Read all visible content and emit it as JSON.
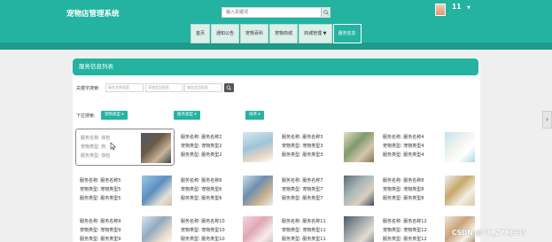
{
  "header": {
    "brand": "宠物店管理系统",
    "search_placeholder": "输入关键词",
    "username": "11",
    "user_caret": "▼"
  },
  "nav": [
    {
      "label": "首页",
      "active": false
    },
    {
      "label": "通知公告",
      "active": false
    },
    {
      "label": "宠物百科",
      "active": false
    },
    {
      "label": "宠物商城",
      "active": false
    },
    {
      "label": "商城管理 ▼",
      "active": false
    },
    {
      "label": "服务信息",
      "active": true
    }
  ],
  "panel": {
    "title": "服务信息列表",
    "keyword_label": "关键字搜索:",
    "inputs": [
      "服务名称搜索",
      "宠物类型搜索",
      "服务类型搜索"
    ],
    "dropdown_label": "下拉搜索:",
    "dropdowns": [
      "宠物类型 ▾",
      "服务类型 ▾",
      "排序 ▾"
    ]
  },
  "cards": [
    {
      "name": "服务名称: 体检",
      "pet": "宠物类型: 狗",
      "service": "服务类型: 体检",
      "photo": "dog-on-lap"
    },
    {
      "name": "服务名称: 服务名称2",
      "pet": "宠物类型: 宠物类型2",
      "service": "服务类型: 服务类型2",
      "photo": "vet-with-kitten"
    },
    {
      "name": "服务名称: 服务名称3",
      "pet": "宠物类型: 宠物类型3",
      "service": "服务类型: 服务类型3",
      "photo": "vet-exam-room"
    },
    {
      "name": "服务名称: 服务名称4",
      "pet": "宠物类型: 宠物类型4",
      "service": "服务类型: 服务类型4",
      "photo": "white-puppy"
    },
    {
      "name": "服务名称: 服务名称5",
      "pet": "宠物类型: 宠物类型5",
      "service": "服务类型: 服务类型5",
      "photo": "vet-in-blue"
    },
    {
      "name": "服务名称: 服务名称6",
      "pet": "宠物类型: 宠物类型6",
      "service": "服务类型: 服务类型6",
      "photo": "vet-with-dog"
    },
    {
      "name": "服务名称: 服务名称7",
      "pet": "宠物类型: 宠物类型7",
      "service": "服务类型: 服务类型7",
      "photo": "clinic-scene"
    },
    {
      "name": "服务名称: 服务名称8",
      "pet": "宠物类型: 宠物类型8",
      "service": "服务类型: 服务类型8",
      "photo": "vet-with-golden-dog"
    },
    {
      "name": "服务名称: 服务名称9",
      "pet": "宠物类型: 宠物类型9",
      "service": "服务类型: 服务类型9",
      "photo": "vet-smiling"
    },
    {
      "name": "服务名称: 服务名称10",
      "pet": "宠物类型: 宠物类型10",
      "service": "服务类型: 服务类型10",
      "photo": "pink-clinic"
    },
    {
      "name": "服务名称: 服务名称11",
      "pet": "宠物类型: 宠物类型11",
      "service": "服务类型: 服务类型11",
      "photo": "vet-desk"
    },
    {
      "name": "服务名称: 服务名称12",
      "pet": "宠物类型: 宠物类型12",
      "service": "服务类型: 服务类型12",
      "photo": "dog-grooming"
    }
  ],
  "side_arrow": "›",
  "watermark": "CSDN @VX_ZYKJ985",
  "colors": {
    "accent": "#24b3a0",
    "accent_dark": "#1e9b8a",
    "nav_bg": "#dcefe9"
  }
}
